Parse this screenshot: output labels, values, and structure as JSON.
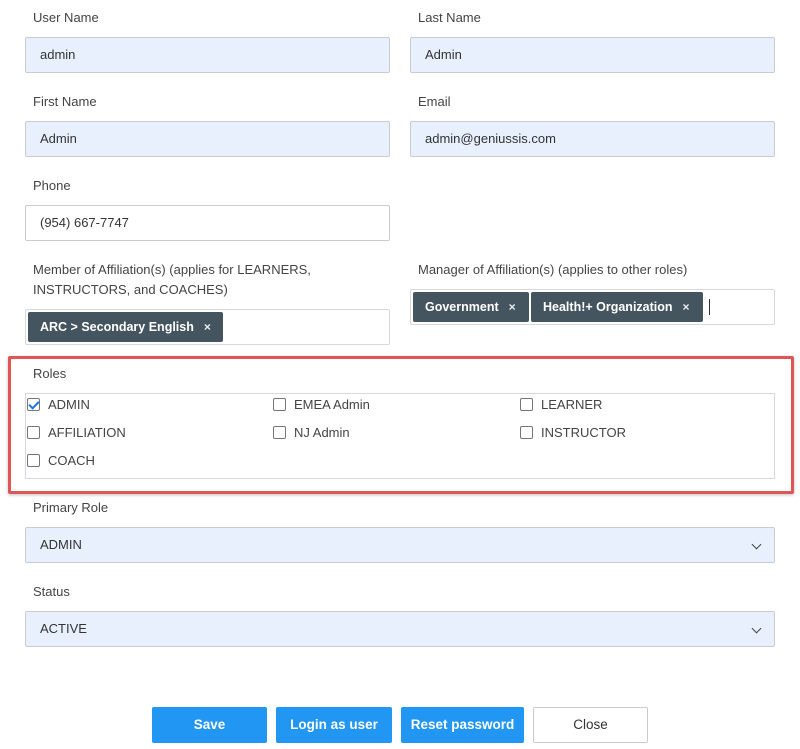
{
  "fields": {
    "username": {
      "label": "User Name",
      "value": "admin"
    },
    "lastname": {
      "label": "Last Name",
      "value": "Admin"
    },
    "firstname": {
      "label": "First Name",
      "value": "Admin"
    },
    "email": {
      "label": "Email",
      "value": "admin@geniussis.com"
    },
    "phone": {
      "label": "Phone",
      "value": "(954) 667-7747"
    }
  },
  "member_affiliations": {
    "label_line1": "Member of Affiliation(s) (applies for LEARNERS,",
    "label_line2": "INSTRUCTORS, and COACHES)",
    "tags": [
      "ARC > Secondary English"
    ]
  },
  "manager_affiliations": {
    "label": "Manager of Affiliation(s) (applies to other roles)",
    "tags": [
      "Government",
      "Health!+ Organization"
    ]
  },
  "tag_remove_glyph": "×",
  "roles": {
    "label": "Roles",
    "items": [
      {
        "label": "ADMIN",
        "checked": true
      },
      {
        "label": "EMEA Admin",
        "checked": false
      },
      {
        "label": "LEARNER",
        "checked": false
      },
      {
        "label": "AFFILIATION",
        "checked": false
      },
      {
        "label": "NJ Admin",
        "checked": false
      },
      {
        "label": "INSTRUCTOR",
        "checked": false
      },
      {
        "label": "COACH",
        "checked": false
      }
    ]
  },
  "primary_role": {
    "label": "Primary Role",
    "value": "ADMIN"
  },
  "status": {
    "label": "Status",
    "value": "ACTIVE"
  },
  "buttons": {
    "save": "Save",
    "login_as_user": "Login as user",
    "reset_password": "Reset password",
    "close": "Close"
  },
  "colors": {
    "accent": "#2196f3",
    "tag_bg": "#455560",
    "highlight": "#e05656",
    "field_bg": "#e8f0fe"
  }
}
